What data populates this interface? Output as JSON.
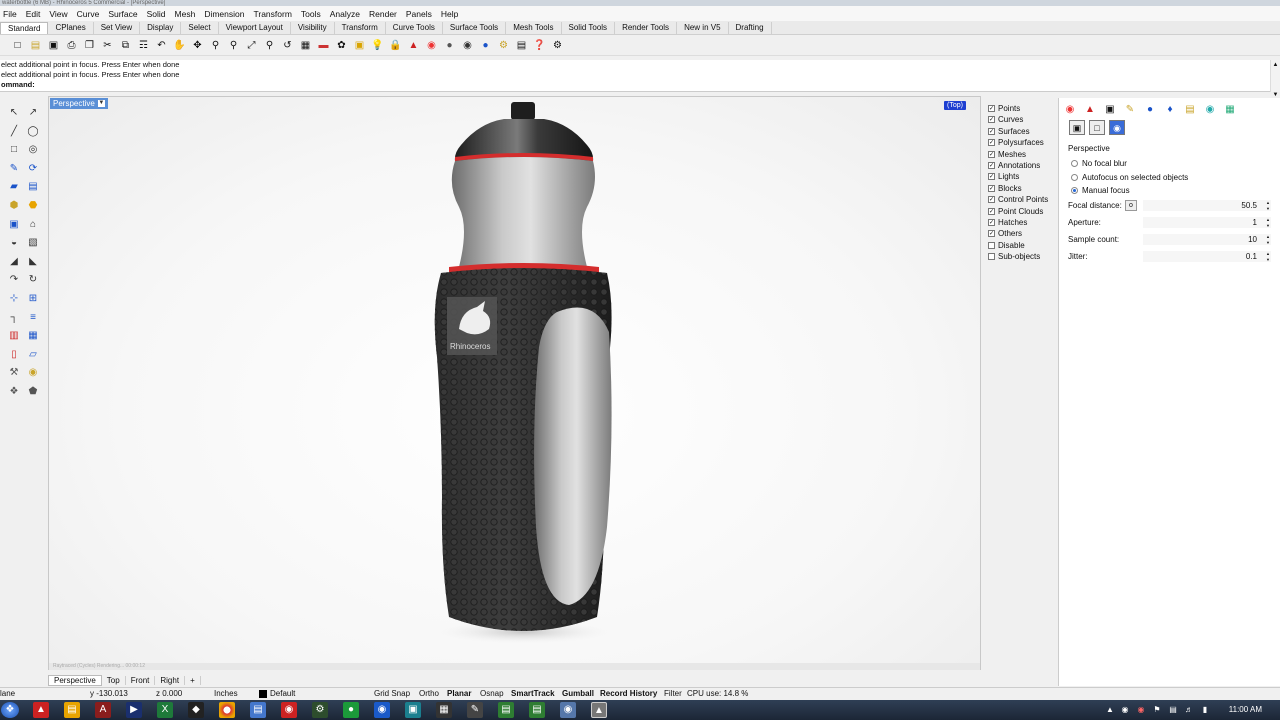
{
  "window": {
    "title": "waterbottle (6 MB) - Rhinoceros 5 Commercial - [Perspective]"
  },
  "menu": [
    "File",
    "Edit",
    "View",
    "Curve",
    "Surface",
    "Solid",
    "Mesh",
    "Dimension",
    "Transform",
    "Tools",
    "Analyze",
    "Render",
    "Panels",
    "Help"
  ],
  "tabs": [
    {
      "label": "Standard",
      "active": true
    },
    {
      "label": "CPlanes"
    },
    {
      "label": "Set View"
    },
    {
      "label": "Display"
    },
    {
      "label": "Select"
    },
    {
      "label": "Viewport Layout"
    },
    {
      "label": "Visibility"
    },
    {
      "label": "Transform"
    },
    {
      "label": "Curve Tools"
    },
    {
      "label": "Surface Tools"
    },
    {
      "label": "Mesh Tools"
    },
    {
      "label": "Solid Tools"
    },
    {
      "label": "Render Tools"
    },
    {
      "label": "New in V5"
    },
    {
      "label": "Drafting"
    }
  ],
  "command": {
    "line1": "elect additional point in focus. Press Enter when done",
    "line2": "elect additional point in focus. Press Enter when done",
    "prompt": "ommand:"
  },
  "viewport": {
    "name": "Perspective",
    "nav_label": "(Top)",
    "status_text": "Raytraced (Cycles)   Rendering...   00:00:12",
    "bottle_logo": "Rhinoceros"
  },
  "object_types": [
    {
      "label": "Points",
      "checked": true
    },
    {
      "label": "Curves",
      "checked": true
    },
    {
      "label": "Surfaces",
      "checked": true
    },
    {
      "label": "Polysurfaces",
      "checked": true
    },
    {
      "label": "Meshes",
      "checked": true
    },
    {
      "label": "Annotations",
      "checked": true
    },
    {
      "label": "Lights",
      "checked": true
    },
    {
      "label": "Blocks",
      "checked": true
    },
    {
      "label": "Control Points",
      "checked": true
    },
    {
      "label": "Point Clouds",
      "checked": true
    },
    {
      "label": "Hatches",
      "checked": true
    },
    {
      "label": "Others",
      "checked": true
    },
    {
      "label": "Disable",
      "checked": false
    },
    {
      "label": "Sub-objects",
      "checked": false
    }
  ],
  "focus_panel": {
    "section": "Perspective",
    "options": [
      {
        "label": "No focal blur",
        "selected": false
      },
      {
        "label": "Autofocus on selected objects",
        "selected": false
      },
      {
        "label": "Manual focus",
        "selected": true
      }
    ],
    "fields": [
      {
        "label": "Focal distance:",
        "value": "50.5"
      },
      {
        "label": "Aperture:",
        "value": "1"
      },
      {
        "label": "Sample count:",
        "value": "10"
      },
      {
        "label": "Jitter:",
        "value": "0.1"
      }
    ],
    "pick_button": "o"
  },
  "view_tabs": [
    "Perspective",
    "Top",
    "Front",
    "Right",
    "+"
  ],
  "status": {
    "plane": "lane",
    "y": "y -130.013",
    "z": "z 0.000",
    "units": "Inches",
    "layer": "Default",
    "grid_snap": "Grid Snap",
    "ortho": "Ortho",
    "planar": "Planar",
    "osnap": "Osnap",
    "smarttrack": "SmartTrack",
    "gumball": "Gumball",
    "record_history": "Record History",
    "filter": "Filter",
    "cpu": "CPU use: 14.8 %"
  },
  "taskbar": {
    "time": "11:00 AM"
  },
  "colors": {
    "accent": "#5a8fd6",
    "nav_label": "#1d3fd1",
    "bottle_red": "#d42d2d"
  }
}
